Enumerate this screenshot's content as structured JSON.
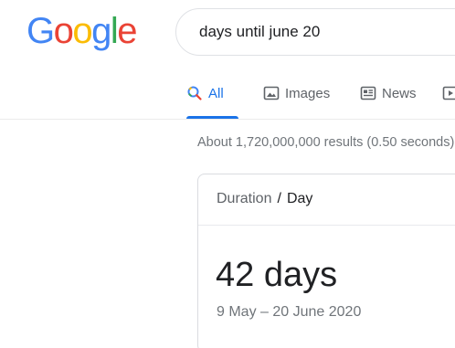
{
  "logo": {
    "letters": [
      "G",
      "o",
      "o",
      "g",
      "l",
      "e"
    ],
    "colors": [
      "#4285f4",
      "#ea4335",
      "#fbbc05",
      "#4285f4",
      "#34a853",
      "#ea4335"
    ]
  },
  "search": {
    "query": "days until june 20"
  },
  "tabs": [
    {
      "label": "All",
      "icon": "search-icon",
      "active": true
    },
    {
      "label": "Images",
      "icon": "image-icon",
      "active": false
    },
    {
      "label": "News",
      "icon": "news-icon",
      "active": false
    },
    {
      "label": "",
      "icon": "video-icon",
      "active": false
    }
  ],
  "result_stats": "About 1,720,000,000 results (0.50 seconds)",
  "answer_card": {
    "unit_type": "Duration",
    "separator": "/",
    "unit": "Day",
    "value": "42 days",
    "range": "9 May – 20 June 2020"
  },
  "colors": {
    "accent": "#1a73e8",
    "text_secondary": "#5f6368",
    "text_muted": "#70757a"
  }
}
